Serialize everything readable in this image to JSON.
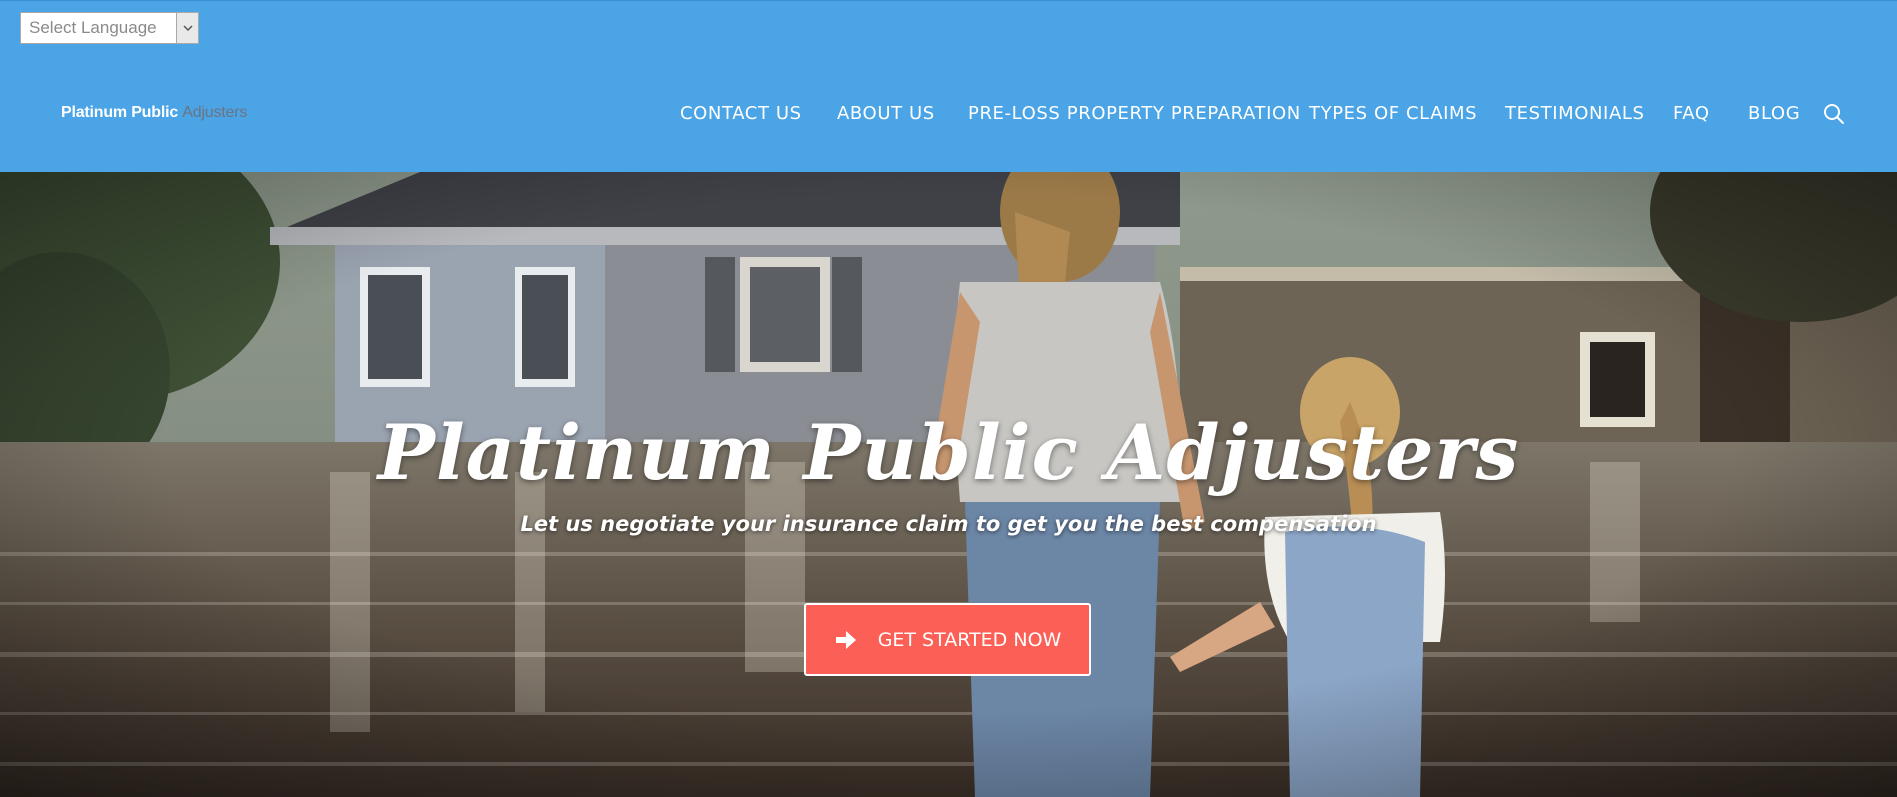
{
  "language_select": {
    "label": "Select Language"
  },
  "logo": {
    "part1": "Platinum Public",
    "part2": "Adjusters"
  },
  "nav": {
    "items": [
      {
        "label": "CONTACT US"
      },
      {
        "label": "ABOUT US"
      },
      {
        "label": "PRE-LOSS PROPERTY PREPARATION"
      },
      {
        "label": "TYPES OF CLAIMS"
      },
      {
        "label": "TESTIMONIALS"
      },
      {
        "label": "FAQ"
      },
      {
        "label": "BLOG"
      }
    ],
    "search_icon": "search-icon"
  },
  "hero": {
    "title": "Platinum Public Adjusters",
    "subtitle": "Let us negotiate your insurance claim to get you the best compensation",
    "cta_label": "GET STARTED NOW",
    "cta_icon": "arrow-right-icon"
  },
  "colors": {
    "header_bg": "#4aa4e6",
    "cta_bg": "#fb5f55",
    "logo_accent": "#6c7482"
  }
}
